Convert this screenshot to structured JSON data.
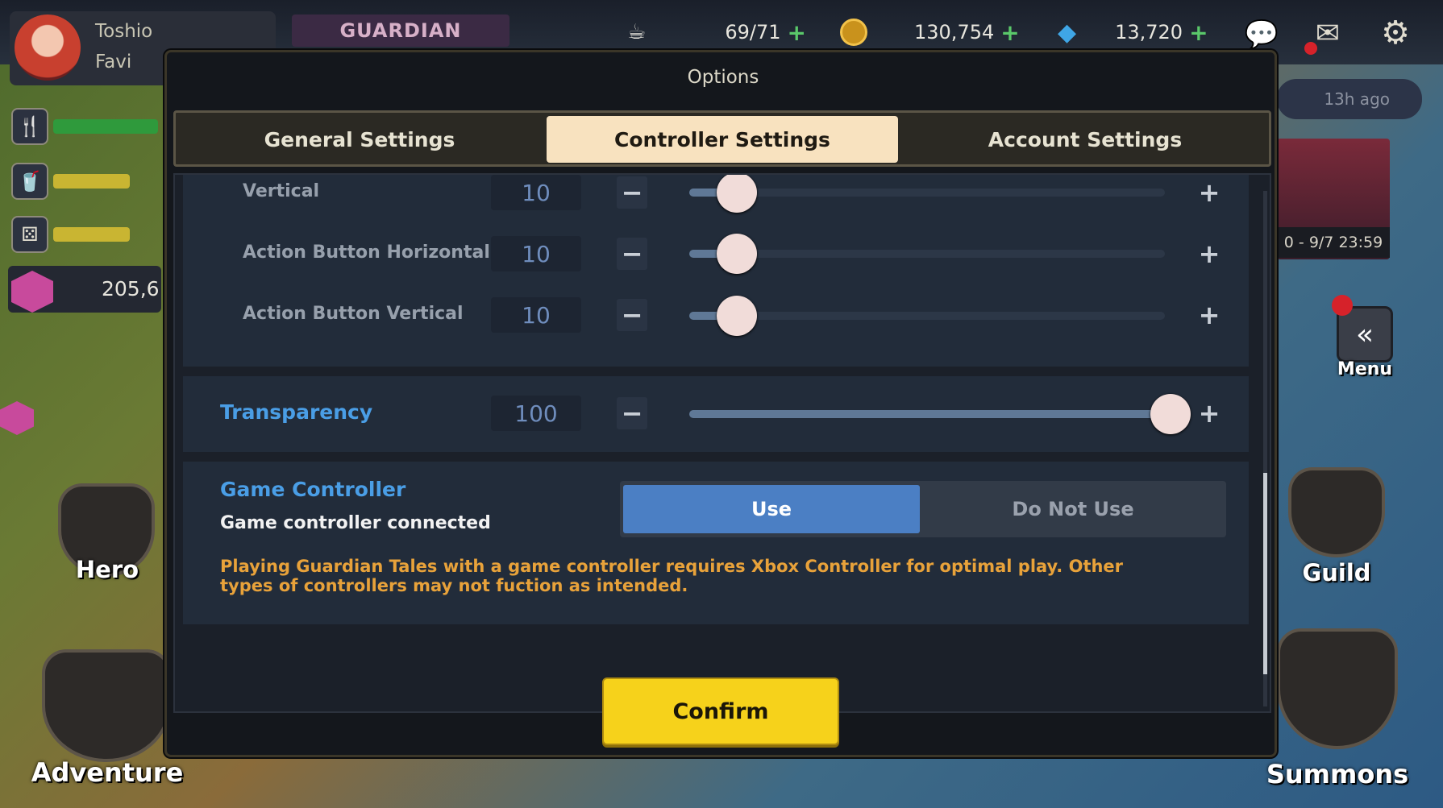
{
  "hud": {
    "player_name": "Toshio",
    "player_title": "Favi",
    "guardian_banner": "GUARDIAN",
    "stamina": "69/71",
    "gold": "130,754",
    "gems": "13,720",
    "side_value": "205,6",
    "notice_time": "13h ago",
    "event_period": "0 - 9/7 23:59",
    "menu_label": "Menu",
    "hero_label": "Hero",
    "adventure_label": "Adventure",
    "guild_label": "Guild",
    "summons_label": "Summons"
  },
  "modal": {
    "title": "Options",
    "tabs": [
      {
        "label": "General Settings",
        "active": false
      },
      {
        "label": "Controller Settings",
        "active": true
      },
      {
        "label": "Account Settings",
        "active": false
      }
    ],
    "sliders": [
      {
        "label": "Vertical",
        "value": "10",
        "fraction": 0.1
      },
      {
        "label": "Action Button Horizontal",
        "value": "10",
        "fraction": 0.1
      },
      {
        "label": "Action Button Vertical",
        "value": "10",
        "fraction": 0.1
      }
    ],
    "transparency": {
      "label": "Transparency",
      "value": "100",
      "fraction": 1.0
    },
    "game_controller": {
      "title": "Game Controller",
      "status": "Game controller connected",
      "use_label": "Use",
      "do_not_use_label": "Do Not Use",
      "selected": "Use",
      "note": "Playing Guardian Tales with a game controller requires Xbox Controller for optimal play. Other types of controllers may not fuction as intended."
    },
    "confirm_label": "Confirm"
  },
  "colors": {
    "accent_blue": "#4a9ee6",
    "confirm_yellow": "#f6d21b",
    "note_orange": "#e8a23a",
    "toggle_active": "#4b7fc4"
  }
}
